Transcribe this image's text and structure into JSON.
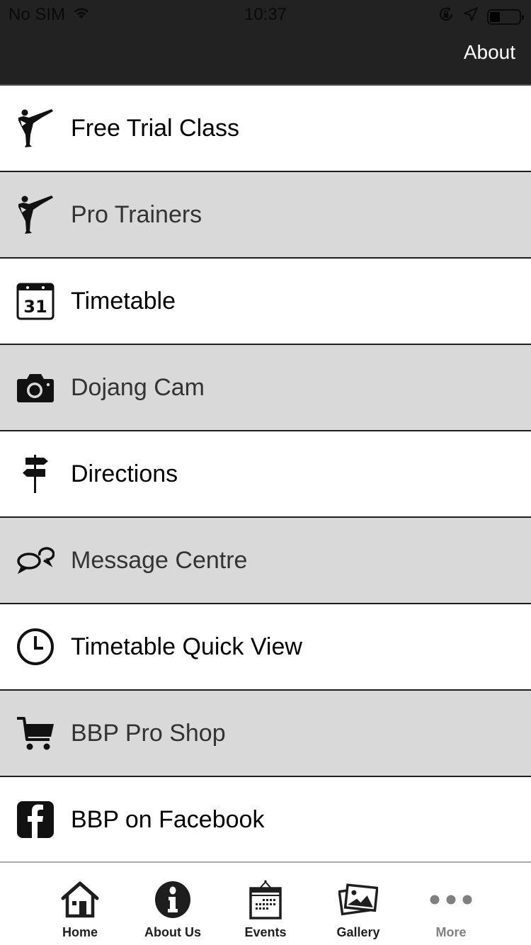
{
  "status_bar": {
    "carrier": "No SIM",
    "time": "10:37",
    "battery_level": 0.35
  },
  "header": {
    "title": "About"
  },
  "menu": {
    "items": [
      {
        "label": "Free Trial Class",
        "icon": "karate-kick-icon"
      },
      {
        "label": "Pro Trainers",
        "icon": "karate-kick-icon"
      },
      {
        "label": "Timetable",
        "icon": "calendar-icon",
        "icon_text": "31"
      },
      {
        "label": "Dojang Cam",
        "icon": "camera-icon"
      },
      {
        "label": "Directions",
        "icon": "signpost-icon"
      },
      {
        "label": "Message Centre",
        "icon": "chat-bubbles-icon"
      },
      {
        "label": "Timetable Quick View",
        "icon": "clock-icon"
      },
      {
        "label": "BBP Pro Shop",
        "icon": "shopping-cart-icon"
      },
      {
        "label": "BBP on Facebook",
        "icon": "facebook-icon"
      }
    ]
  },
  "tabbar": {
    "tabs": [
      {
        "label": "Home",
        "icon": "home-icon"
      },
      {
        "label": "About Us",
        "icon": "info-icon"
      },
      {
        "label": "Events",
        "icon": "events-calendar-icon"
      },
      {
        "label": "Gallery",
        "icon": "gallery-icon"
      },
      {
        "label": "More",
        "icon": "more-dots-icon"
      }
    ]
  },
  "colors": {
    "header_bg": "#222222",
    "row_gray": "#d9d9d9",
    "row_white": "#ffffff",
    "divider": "#1e1e1e",
    "tab_inactive": "#808080"
  }
}
